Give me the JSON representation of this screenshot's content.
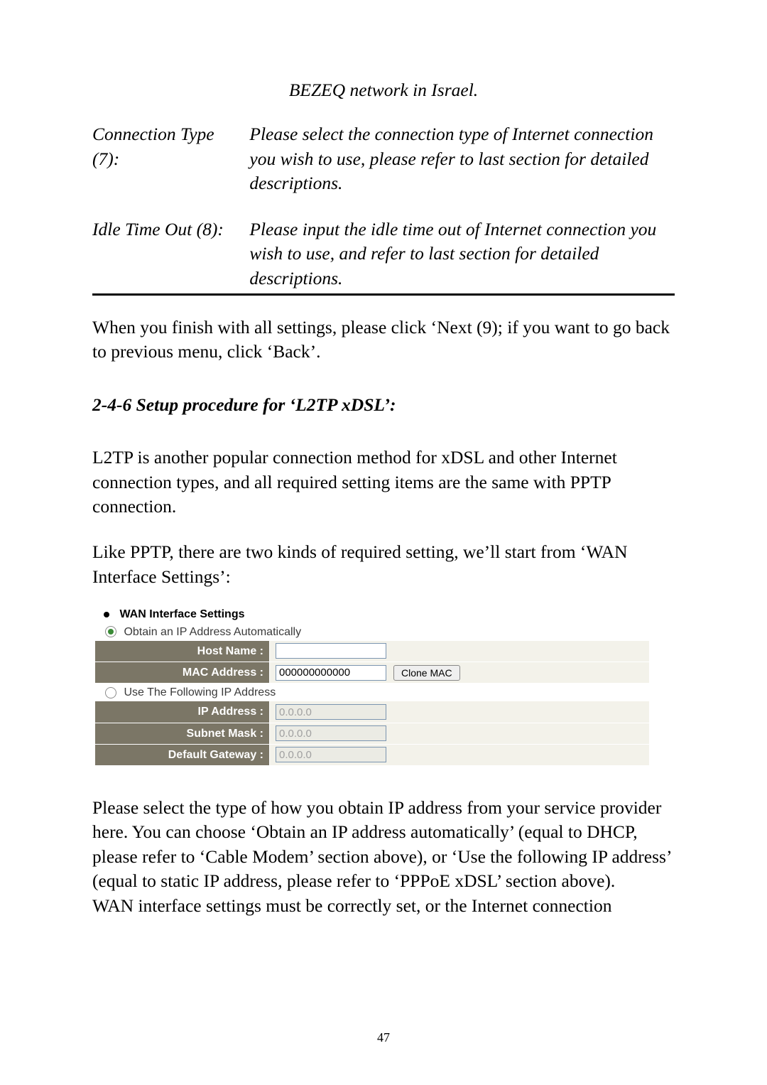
{
  "top_italic": "BEZEQ network in Israel.",
  "def7": {
    "label": "Connection Type (7):",
    "body": "Please select the connection type of Internet connection you wish to use, please refer to last section for detailed descriptions."
  },
  "def8": {
    "label": "Idle Time Out (8):",
    "body": "Please input the idle time out of Internet connection you wish to use, and refer to last section for detailed descriptions."
  },
  "after_rule": "When you finish with all settings, please click ‘Next (9); if you want to go back to previous menu, click ‘Back’.",
  "heading": "2-4-6 Setup procedure for ‘L2TP xDSL’:",
  "para1": "L2TP is another popular connection method for xDSL and other Internet connection types, and all required setting items are the same with PPTP connection.",
  "para2": "Like PPTP, there are two kinds of required setting, we’ll start from ‘WAN Interface Settings’:",
  "wan": {
    "title": "WAN Interface Settings",
    "radio1": "Obtain an IP Address Automatically",
    "radio2": "Use The Following IP Address",
    "rows": {
      "hostname": {
        "label": "Host Name :",
        "value": ""
      },
      "mac": {
        "label": "MAC Address :",
        "value": "000000000000",
        "button": "Clone MAC"
      },
      "ip": {
        "label": "IP Address :",
        "value": "0.0.0.0"
      },
      "mask": {
        "label": "Subnet Mask :",
        "value": "0.0.0.0"
      },
      "gw": {
        "label": "Default Gateway :",
        "value": "0.0.0.0"
      }
    }
  },
  "closing1": "Please select the type of how you obtain IP address from your service provider here. You can choose ‘Obtain an IP address automatically’ (equal to DHCP, please refer to ‘Cable Modem’ section above), or ‘Use the following IP address’ (equal to static IP address, please refer to ‘PPPoE xDSL’ section above).",
  "closing2": "WAN interface settings must be correctly set, or the Internet connection",
  "page_number": "47",
  "chart_data": {
    "type": "table",
    "title": "WAN Interface Settings",
    "rows": [
      {
        "label": "Host Name",
        "value": ""
      },
      {
        "label": "MAC Address",
        "value": "000000000000"
      },
      {
        "label": "IP Address",
        "value": "0.0.0.0"
      },
      {
        "label": "Subnet Mask",
        "value": "0.0.0.0"
      },
      {
        "label": "Default Gateway",
        "value": "0.0.0.0"
      }
    ]
  }
}
